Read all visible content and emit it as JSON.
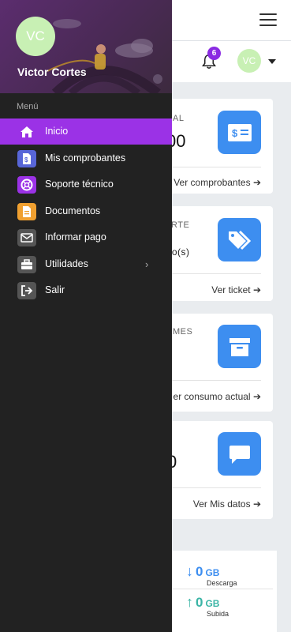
{
  "drawer": {
    "user_initials": "VC",
    "user_name": "Victor Cortes",
    "menu_title": "Menú",
    "items": [
      {
        "label": "Inicio",
        "icon": "home-icon",
        "active": true,
        "color": "#9b32e6"
      },
      {
        "label": "Mis comprobantes",
        "icon": "receipt-icon",
        "color": "#5866d8"
      },
      {
        "label": "Soporte técnico",
        "icon": "lifebuoy-icon",
        "color": "#9b32e6"
      },
      {
        "label": "Documentos",
        "icon": "document-icon",
        "color": "#f0a030"
      },
      {
        "label": "Informar pago",
        "icon": "envelope-icon",
        "color": "#555555"
      },
      {
        "label": "Utilidades",
        "icon": "toolbox-icon",
        "color": "#555555",
        "has_submenu": true
      },
      {
        "label": "Salir",
        "icon": "sign-out-icon",
        "color": "#555555"
      }
    ]
  },
  "header": {
    "notification_count": "6",
    "avatar_initials": "VC"
  },
  "cards": [
    {
      "label": "AL",
      "value": "00",
      "link": "Ver comprobantes",
      "icon": "invoice-icon"
    },
    {
      "label": "RTE",
      "value": "to(s)",
      "link": "Ver ticket",
      "icon": "tags-icon"
    },
    {
      "label": "MES",
      "value": "",
      "link": "er consumo actual",
      "icon": "archive-icon"
    },
    {
      "label": "",
      "value": "0",
      "link": "Ver Mis datos",
      "icon": "comment-icon"
    }
  ],
  "traffic": {
    "download_value": "0",
    "download_unit": "GB",
    "download_label": "Descarga",
    "upload_value": "0",
    "upload_unit": "GB",
    "upload_label": "Subida"
  },
  "colors": {
    "accent": "#9b32e6",
    "card_icon": "#3d8ef0",
    "download": "#3d8ef0",
    "upload": "#3bb5a6",
    "drawer_bg": "#222222"
  }
}
